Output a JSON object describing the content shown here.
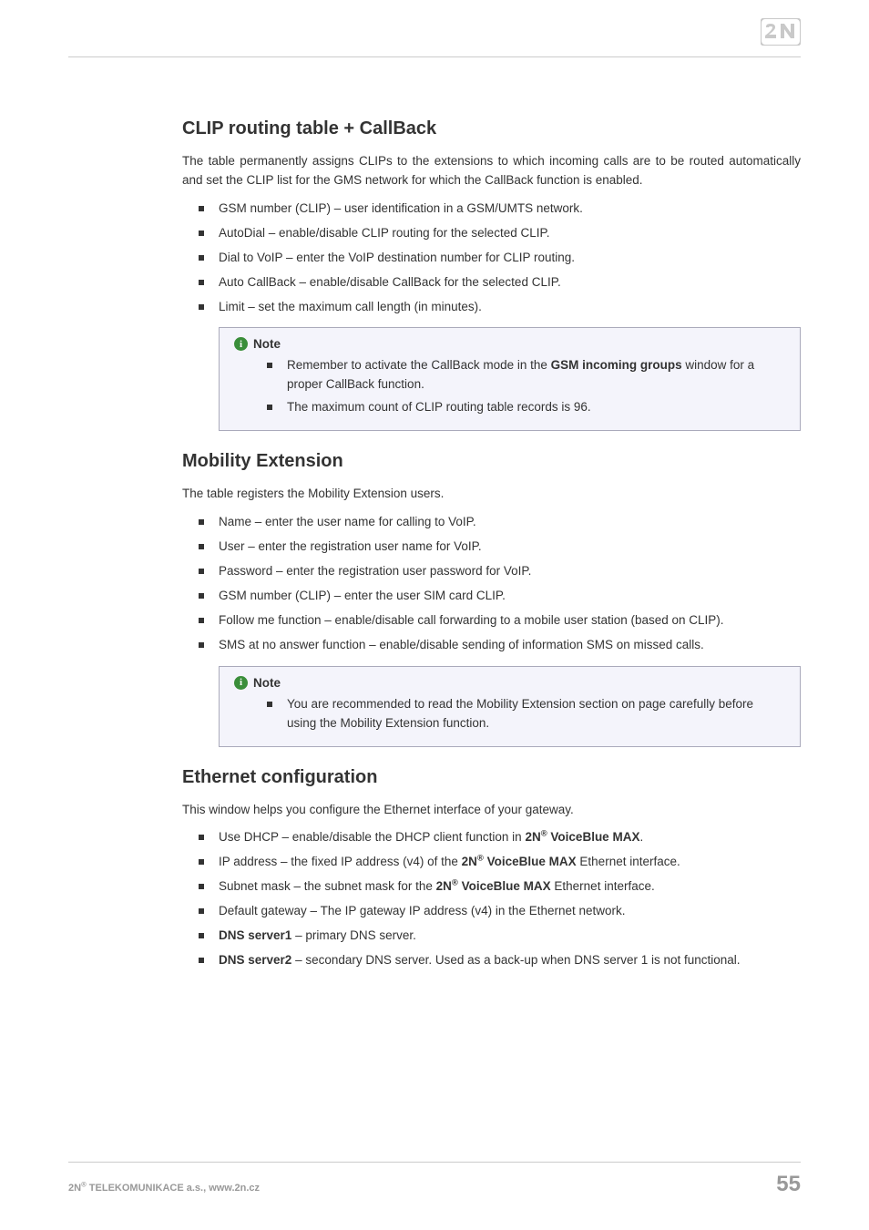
{
  "logo_alt": "2N",
  "sections": {
    "clip": {
      "heading": "CLIP routing table + CallBack",
      "intro": "The table permanently assigns CLIPs to the extensions to which incoming calls are to be routed automatically and set the CLIP list for the GMS network for which the CallBack function is enabled.",
      "items": {
        "i0": "GSM number (CLIP) – user identification in a GSM/UMTS network.",
        "i1": "AutoDial – enable/disable CLIP routing for the selected CLIP.",
        "i2": "Dial to VoIP – enter the VoIP destination number for CLIP routing.",
        "i3": "Auto CallBack – enable/disable CallBack for the selected CLIP.",
        "i4": "Limit – set the maximum call length (in minutes)."
      },
      "note_label": "Note",
      "note": {
        "n0_pre": "Remember to activate the CallBack mode in the ",
        "n0_bold": "GSM incoming groups",
        "n0_post": " window for a proper CallBack function.",
        "n1": "The maximum count of CLIP routing table records is 96."
      }
    },
    "mobility": {
      "heading": "Mobility Extension",
      "intro": "The table registers the Mobility Extension users.",
      "items": {
        "i0": "Name – enter the user name for calling to VoIP.",
        "i1": "User – enter the registration user name for VoIP.",
        "i2": "Password – enter the registration user password for VoIP.",
        "i3": "GSM number (CLIP) – enter the user SIM card CLIP.",
        "i4": "Follow me function – enable/disable call forwarding to a mobile user station (based on CLIP).",
        "i5": "SMS at no answer function – enable/disable sending of information SMS on missed calls."
      },
      "note_label": "Note",
      "note": {
        "n0": "You are recommended to read the Mobility Extension section on page carefully before using the Mobility Extension function."
      }
    },
    "ethernet": {
      "heading": "Ethernet configuration",
      "intro": "This window helps you configure the Ethernet interface of your gateway.",
      "items": {
        "i0_pre": "Use DHCP – enable/disable the DHCP client function in ",
        "i0_bold": "2N",
        "i0_sup": "®",
        "i0_bold2": " VoiceBlue MAX",
        "i0_post": ".",
        "i1_pre": "IP address – the fixed IP address (v4) of the ",
        "i1_bold": "2N",
        "i1_sup": "®",
        "i1_bold2": " VoiceBlue MAX",
        "i1_post": " Ethernet interface.",
        "i2_pre": "Subnet mask – the subnet mask for the ",
        "i2_bold": "2N",
        "i2_sup": "®",
        "i2_bold2": " VoiceBlue MAX",
        "i2_post": " Ethernet interface.",
        "i3": "Default gateway – The IP gateway IP address (v4) in the Ethernet network.",
        "i4_bold": "DNS server1",
        "i4_post": " – primary DNS server.",
        "i5_bold": "DNS server2",
        "i5_post": " – secondary DNS server. Used as a back-up when DNS server 1 is not functional."
      }
    }
  },
  "footer": {
    "company_pre": "2N",
    "company_sup": "®",
    "company_post": " TELEKOMUNIKACE a.s., www.2n.cz",
    "page": "55"
  }
}
